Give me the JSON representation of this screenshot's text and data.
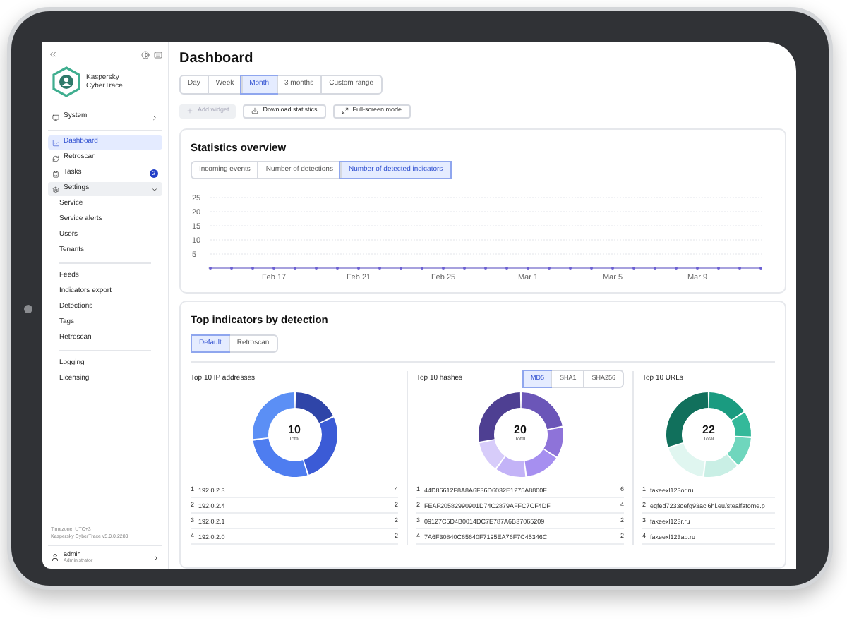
{
  "sidebar": {
    "logo_text": "Kaspersky CyberTrace",
    "items": [
      {
        "label": "System",
        "kind": "system",
        "selected": false,
        "expanded": false
      },
      {
        "label": "Dashboard",
        "kind": "dashboard",
        "selected": true
      },
      {
        "label": "Retroscan",
        "kind": "retroscan",
        "selected": false
      },
      {
        "label": "Tasks",
        "kind": "tasks",
        "selected": false,
        "badge": "2"
      },
      {
        "label": "Settings",
        "kind": "settings",
        "selected": false,
        "expanded": true,
        "children": [
          {
            "label": "Service",
            "selected": false,
            "separated": false
          },
          {
            "label": "Service alerts",
            "selected": false,
            "separated": false
          },
          {
            "label": "Users",
            "selected": false,
            "separated": false
          },
          {
            "label": "Tenants",
            "selected": false,
            "separated": false
          },
          {
            "label": "Feeds",
            "selected": false,
            "separated": true
          },
          {
            "label": "Indicators export",
            "selected": false,
            "separated": false
          },
          {
            "label": "Detections",
            "selected": false,
            "separated": false
          },
          {
            "label": "Tags",
            "selected": false,
            "separated": false
          },
          {
            "label": "Retroscan",
            "selected": false,
            "separated": false
          },
          {
            "label": "Logging",
            "selected": false,
            "separated": true
          },
          {
            "label": "Licensing",
            "selected": false,
            "separated": false
          }
        ]
      }
    ],
    "footer": {
      "timezone": "Timezone: UTC+3",
      "version": "Kaspersky CyberTrace v5.0.0.2280"
    },
    "user": {
      "name": "admin",
      "role": "Administrator"
    }
  },
  "page": {
    "title": "Dashboard"
  },
  "range_tabs": [
    {
      "label": "Day",
      "selected": false
    },
    {
      "label": "Week",
      "selected": false
    },
    {
      "label": "Month",
      "selected": true
    },
    {
      "label": "3 months",
      "selected": false
    },
    {
      "label": "Custom range",
      "selected": false
    }
  ],
  "toolbar": [
    {
      "label": "Add widget",
      "kind": "add",
      "disabled": true
    },
    {
      "label": "Download statistics",
      "kind": "download",
      "disabled": false
    },
    {
      "label": "Full-screen mode",
      "kind": "fullscreen",
      "disabled": false
    }
  ],
  "statistics": {
    "title": "Statistics overview",
    "tabs": [
      {
        "label": "Incoming events",
        "selected": false
      },
      {
        "label": "Number of detections",
        "selected": false
      },
      {
        "label": "Number of detected indicators",
        "selected": true
      }
    ],
    "chart_data": {
      "type": "line",
      "categories": [
        null,
        null,
        null,
        "Feb 17",
        null,
        null,
        null,
        "Feb 21",
        null,
        null,
        null,
        "Feb 25",
        null,
        null,
        null,
        "Mar 1",
        null,
        null,
        null,
        "Mar 5",
        null,
        null,
        null,
        "Mar 9",
        null,
        null,
        null
      ],
      "series": [
        {
          "color": "#6b5fd3",
          "values": [
            0,
            0,
            0,
            0,
            0,
            0,
            0,
            0,
            0,
            0,
            0,
            0,
            0,
            0,
            0,
            0,
            0,
            0,
            0,
            0,
            0,
            0,
            0,
            0,
            0,
            0,
            0
          ]
        }
      ],
      "ylim": [
        0,
        25
      ],
      "yticks": [
        5,
        10,
        15,
        20,
        25
      ],
      "grid": true
    }
  },
  "top_indicators": {
    "title": "Top indicators by detection",
    "tabs": [
      {
        "label": "Default",
        "selected": true
      },
      {
        "label": "Retroscan",
        "selected": false
      }
    ],
    "panels": [
      {
        "title": "Top 10 IP addresses",
        "kind": "ip",
        "total": "10",
        "total_label": "Total",
        "rows": [
          {
            "rank": "1",
            "value": "192.0.2.3",
            "count": "4"
          },
          {
            "rank": "2",
            "value": "192.0.2.4",
            "count": "2"
          },
          {
            "rank": "3",
            "value": "192.0.2.1",
            "count": "2"
          },
          {
            "rank": "4",
            "value": "192.0.2.0",
            "count": "2"
          }
        ]
      },
      {
        "title": "Top 10 hashes",
        "kind": "hash",
        "total": "20",
        "total_label": "Total",
        "hash_tabs": [
          {
            "label": "MD5",
            "selected": true
          },
          {
            "label": "SHA1",
            "selected": false
          },
          {
            "label": "SHA256",
            "selected": false
          }
        ],
        "rows": [
          {
            "rank": "1",
            "value": "44D86612F8A8A6F36D6032E1275A8800F",
            "count": "6"
          },
          {
            "rank": "2",
            "value": "FEAF20582990901D74C2879AFFC7CF4DF",
            "count": "4"
          },
          {
            "rank": "3",
            "value": "09127C5D4B0014DC7E787A6B37065209",
            "count": "2"
          },
          {
            "rank": "4",
            "value": "7A6F30840C65640F7195EA76F7C45346C",
            "count": "2"
          }
        ]
      },
      {
        "title": "Top 10 URLs",
        "kind": "url",
        "total": "22",
        "total_label": "Total",
        "rows": [
          {
            "rank": "1",
            "value": "fakeexl123or.ru"
          },
          {
            "rank": "2",
            "value": "eqfed7233defg93aci6hl.eu/stealfatome.p"
          },
          {
            "rank": "3",
            "value": "fakeexl123r.ru"
          },
          {
            "rank": "4",
            "value": "fakeexl123ap.ru"
          }
        ]
      }
    ]
  }
}
